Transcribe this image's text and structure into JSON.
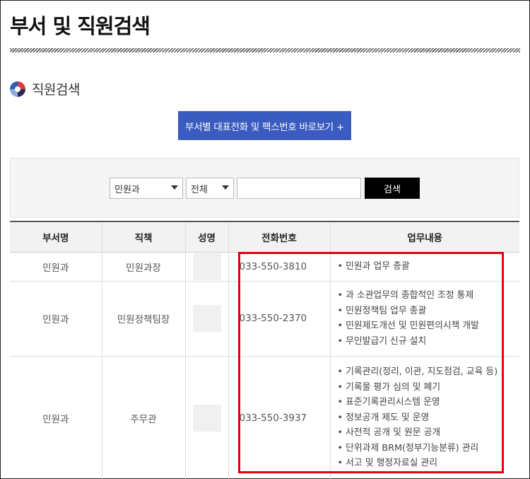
{
  "page": {
    "title": "부서 및 직원검색"
  },
  "section": {
    "title": "직원검색"
  },
  "colors": {
    "accent": "#3a5bbf",
    "highlight": "#e3000f",
    "icon": [
      "#2d5fb3",
      "#d93a3a",
      "#2a2a5a",
      "#8fa9dd"
    ]
  },
  "dept_button": {
    "label": "부서별 대표전화 및 팩스번호 바로보기 +"
  },
  "search": {
    "dept_select": "민원과",
    "scope_select": "전체",
    "keyword": "",
    "button_label": "검색"
  },
  "table": {
    "headers": [
      "부서명",
      "직책",
      "성명",
      "전화번호",
      "업무내용"
    ],
    "rows": [
      {
        "dept": "민원과",
        "position": "민원과장",
        "name": "",
        "phone": "033-550-3810",
        "duties": [
          "민원과 업무 총괄"
        ]
      },
      {
        "dept": "민원과",
        "position": "민원정책팀장",
        "name": "",
        "phone": "033-550-2370",
        "duties": [
          "과 소관업무의 종합적인 조정 통제",
          "민원정책팀 업무 총괄",
          "민원제도개선 및 민원편의시책 개발",
          "무인발급기 신규 설치"
        ]
      },
      {
        "dept": "민원과",
        "position": "주무관",
        "name": "",
        "phone": "033-550-3937",
        "duties": [
          "기록관리(정리, 이관, 지도점검, 교육 등)",
          "기록물 평가 심의 및 폐기",
          "표준기록관리시스템 운영",
          "정보공개 제도 및 운영",
          "사전적 공개 및 원문 공개",
          "단위과제 BRM(정부기능분류) 관리",
          "서고 및 행정자료실 관리"
        ]
      }
    ]
  }
}
